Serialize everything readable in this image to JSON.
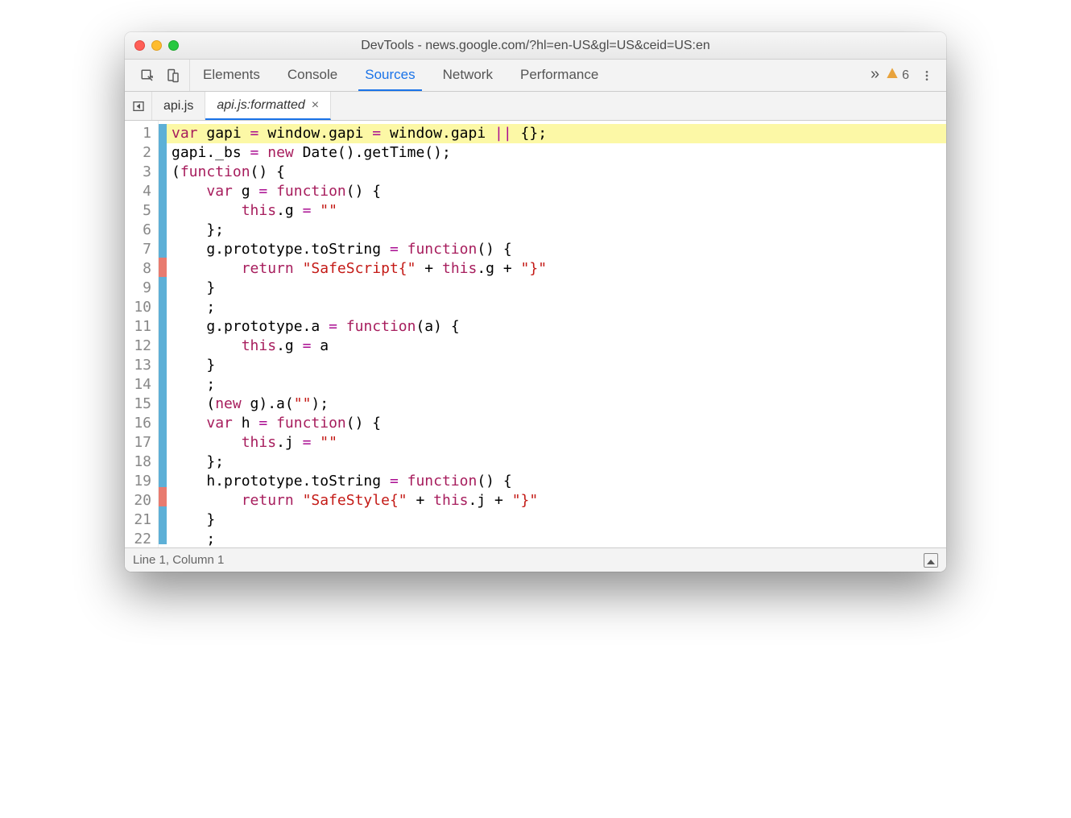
{
  "window": {
    "title": "DevTools - news.google.com/?hl=en-US&gl=US&ceid=US:en"
  },
  "toolbar": {
    "tabs": [
      {
        "label": "Elements",
        "active": false
      },
      {
        "label": "Console",
        "active": false
      },
      {
        "label": "Sources",
        "active": true
      },
      {
        "label": "Network",
        "active": false
      },
      {
        "label": "Performance",
        "active": false
      }
    ],
    "overflow_label": "»",
    "warning_count": "6"
  },
  "file_tabs": [
    {
      "label": "api.js",
      "active": false,
      "closable": false
    },
    {
      "label": "api.js:formatted",
      "active": true,
      "closable": true
    }
  ],
  "status": {
    "position": "Line 1, Column 1"
  },
  "code": {
    "lines": [
      {
        "n": 1,
        "marker": "blue",
        "hl": true,
        "tokens": [
          [
            "kw",
            "var"
          ],
          [
            "",
            " gapi "
          ],
          [
            "op",
            "="
          ],
          [
            "",
            " window.gapi "
          ],
          [
            "op",
            "="
          ],
          [
            "",
            " window.gapi "
          ],
          [
            "op",
            "||"
          ],
          [
            "",
            " {};"
          ]
        ]
      },
      {
        "n": 2,
        "marker": "blue",
        "tokens": [
          [
            "",
            "gapi._bs "
          ],
          [
            "op",
            "="
          ],
          [
            "",
            " "
          ],
          [
            "kw",
            "new"
          ],
          [
            "",
            " Date().getTime();"
          ]
        ]
      },
      {
        "n": 3,
        "marker": "blue",
        "tokens": [
          [
            "",
            "("
          ],
          [
            "kw",
            "function"
          ],
          [
            "",
            "() {"
          ]
        ]
      },
      {
        "n": 4,
        "marker": "blue",
        "tokens": [
          [
            "",
            "    "
          ],
          [
            "kw",
            "var"
          ],
          [
            "",
            " g "
          ],
          [
            "op",
            "="
          ],
          [
            "",
            " "
          ],
          [
            "kw",
            "function"
          ],
          [
            "",
            "() {"
          ]
        ]
      },
      {
        "n": 5,
        "marker": "blue",
        "tokens": [
          [
            "",
            "        "
          ],
          [
            "kw",
            "this"
          ],
          [
            "",
            ".g "
          ],
          [
            "op",
            "="
          ],
          [
            "",
            " "
          ],
          [
            "str",
            "\"\""
          ]
        ]
      },
      {
        "n": 6,
        "marker": "blue",
        "tokens": [
          [
            "",
            "    };"
          ]
        ]
      },
      {
        "n": 7,
        "marker": "blue",
        "tokens": [
          [
            "",
            "    g.prototype.toString "
          ],
          [
            "op",
            "="
          ],
          [
            "",
            " "
          ],
          [
            "kw",
            "function"
          ],
          [
            "",
            "() {"
          ]
        ]
      },
      {
        "n": 8,
        "marker": "red",
        "tokens": [
          [
            "",
            "        "
          ],
          [
            "kw",
            "return"
          ],
          [
            "",
            " "
          ],
          [
            "str",
            "\"SafeScript{\""
          ],
          [
            "",
            " + "
          ],
          [
            "kw",
            "this"
          ],
          [
            "",
            ".g + "
          ],
          [
            "str",
            "\"}\""
          ]
        ]
      },
      {
        "n": 9,
        "marker": "blue",
        "tokens": [
          [
            "",
            "    }"
          ]
        ]
      },
      {
        "n": 10,
        "marker": "blue",
        "tokens": [
          [
            "",
            "    ;"
          ]
        ]
      },
      {
        "n": 11,
        "marker": "blue",
        "tokens": [
          [
            "",
            "    g.prototype.a "
          ],
          [
            "op",
            "="
          ],
          [
            "",
            " "
          ],
          [
            "kw",
            "function"
          ],
          [
            "",
            "(a) {"
          ]
        ]
      },
      {
        "n": 12,
        "marker": "blue",
        "tokens": [
          [
            "",
            "        "
          ],
          [
            "kw",
            "this"
          ],
          [
            "",
            ".g "
          ],
          [
            "op",
            "="
          ],
          [
            "",
            " a"
          ]
        ]
      },
      {
        "n": 13,
        "marker": "blue",
        "tokens": [
          [
            "",
            "    }"
          ]
        ]
      },
      {
        "n": 14,
        "marker": "blue",
        "tokens": [
          [
            "",
            "    ;"
          ]
        ]
      },
      {
        "n": 15,
        "marker": "blue",
        "tokens": [
          [
            "",
            "    ("
          ],
          [
            "kw",
            "new"
          ],
          [
            "",
            " g).a("
          ],
          [
            "str",
            "\"\""
          ],
          [
            "",
            ");"
          ]
        ]
      },
      {
        "n": 16,
        "marker": "blue",
        "tokens": [
          [
            "",
            "    "
          ],
          [
            "kw",
            "var"
          ],
          [
            "",
            " h "
          ],
          [
            "op",
            "="
          ],
          [
            "",
            " "
          ],
          [
            "kw",
            "function"
          ],
          [
            "",
            "() {"
          ]
        ]
      },
      {
        "n": 17,
        "marker": "blue",
        "tokens": [
          [
            "",
            "        "
          ],
          [
            "kw",
            "this"
          ],
          [
            "",
            ".j "
          ],
          [
            "op",
            "="
          ],
          [
            "",
            " "
          ],
          [
            "str",
            "\"\""
          ]
        ]
      },
      {
        "n": 18,
        "marker": "blue",
        "tokens": [
          [
            "",
            "    };"
          ]
        ]
      },
      {
        "n": 19,
        "marker": "blue",
        "tokens": [
          [
            "",
            "    h.prototype.toString "
          ],
          [
            "op",
            "="
          ],
          [
            "",
            " "
          ],
          [
            "kw",
            "function"
          ],
          [
            "",
            "() {"
          ]
        ]
      },
      {
        "n": 20,
        "marker": "red",
        "tokens": [
          [
            "",
            "        "
          ],
          [
            "kw",
            "return"
          ],
          [
            "",
            " "
          ],
          [
            "str",
            "\"SafeStyle{\""
          ],
          [
            "",
            " + "
          ],
          [
            "kw",
            "this"
          ],
          [
            "",
            ".j + "
          ],
          [
            "str",
            "\"}\""
          ]
        ]
      },
      {
        "n": 21,
        "marker": "blue",
        "tokens": [
          [
            "",
            "    }"
          ]
        ]
      },
      {
        "n": 22,
        "marker": "blue",
        "tokens": [
          [
            "",
            "    ;"
          ]
        ]
      }
    ]
  }
}
